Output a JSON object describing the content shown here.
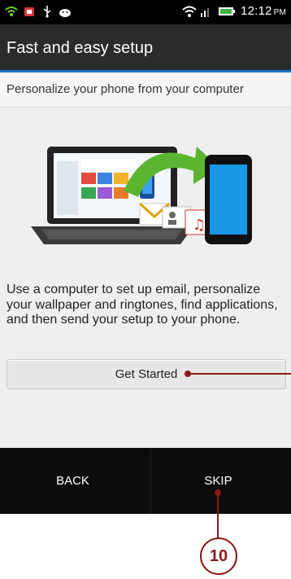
{
  "status_bar": {
    "time": "12:12",
    "ampm": "PM",
    "icons": [
      "wifi-notification-icon",
      "app-notification-icon",
      "usb-icon",
      "android-notification-icon",
      "wifi-icon",
      "signal-icon",
      "battery-icon"
    ]
  },
  "title_bar": {
    "title": "Fast and easy setup"
  },
  "subtitle": "Personalize your phone from your computer",
  "body_text": "Use a computer to set up email, personalize your wallpaper and ringtones, find applications, and then send your setup to your phone.",
  "buttons": {
    "get_started": "Get Started",
    "back": "BACK",
    "skip": "SKIP"
  },
  "callout": {
    "number": "10"
  },
  "colors": {
    "accent": "#1b73c8",
    "callout": "#8b1a1a",
    "title_bar": "#2b2b2b",
    "bottom_bar": "#0c0c0c"
  }
}
